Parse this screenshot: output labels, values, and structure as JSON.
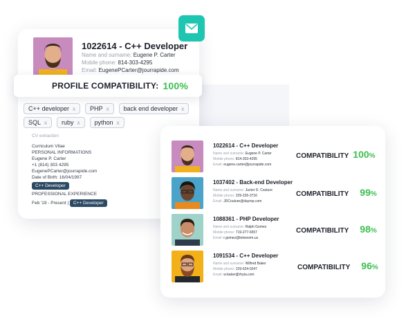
{
  "accent_color": "#3bbf4f",
  "mail_button_color": "#1ec6b2",
  "pill_color": "#2d4a64",
  "profile": {
    "id_title": "1022614 - C++ Developer",
    "name_label": "Name and surname:",
    "name": "Eugene P. Carter",
    "phone_label": "Mobile phone:",
    "phone": "814-303-4295",
    "email_label": "Email:",
    "email": "EugenePCarter@jourrapide.com",
    "compat_label": "PROFILE COMPATIBILITY:",
    "compat_value": "100%"
  },
  "skills": [
    {
      "label": "C++ developer",
      "remove": "x"
    },
    {
      "label": "PHP",
      "remove": "x"
    },
    {
      "label": "back end developer",
      "remove": "x"
    },
    {
      "label": "SQL",
      "remove": "x"
    },
    {
      "label": "ruby",
      "remove": "x"
    },
    {
      "label": "python",
      "remove": "x"
    }
  ],
  "cv": {
    "heading": "CV extraction",
    "l1": "Curriculum Vitae",
    "l2": "PERSONAL INFORMATIONS",
    "l3": "Eugene P. Carter",
    "l4": "+1 (814) 303 4295",
    "l5": "EugenePCarter@jourrapide.com",
    "l6": "Date of Birth: 16/04/1997",
    "tag1": "C++ Developer",
    "l7": "PROFESSIONAL EXPERIENCE",
    "l8": "Feb '19 - Present  |",
    "tag2": "C++ Developer"
  },
  "candidates": [
    {
      "title": "1022614 - C++ Developer",
      "name": "Eugene P. Carter",
      "phone": "814-303-4295",
      "email": "eugene.carter@jourrapide.com",
      "compat_label": "COMPATIBILITY",
      "compat_num": "100",
      "compat_unit": "%"
    },
    {
      "title": "1037402 - Back-end Developer",
      "name": "Junior D. Couture",
      "phone": "229-226-3716",
      "email": "JDCouture@dayrep.com",
      "compat_label": "COMPATIBILITY",
      "compat_num": "99",
      "compat_unit": "%"
    },
    {
      "title": "1088361 - PHP Developer",
      "name": "Ralph Gomez",
      "phone": "719-277-6557",
      "email": "r.gomez@teleworm.us",
      "compat_label": "COMPATIBILITY",
      "compat_num": "98",
      "compat_unit": "%"
    },
    {
      "title": "1091534 - C++ Developer",
      "name": "Wilfred Baker",
      "phone": "229-624-0247",
      "email": "w.baker@rhyta.com",
      "compat_label": "COMPATIBILITY",
      "compat_num": "96",
      "compat_unit": "%"
    }
  ],
  "labels": {
    "name": "Name and surname:",
    "phone": "Mobile phone:",
    "email": "Email:"
  }
}
